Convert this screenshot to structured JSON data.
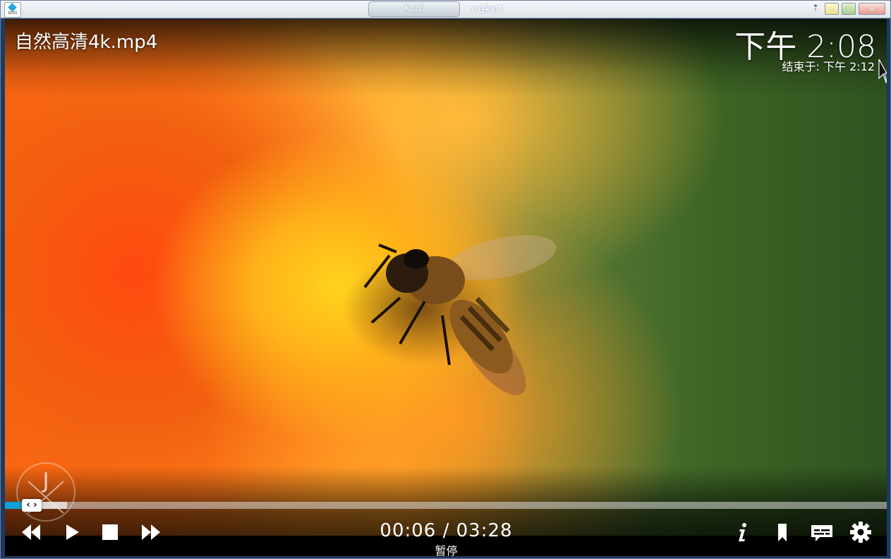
{
  "window": {
    "tab_label": "Kodi",
    "title": "veket",
    "app_icon_text": "KODI"
  },
  "player": {
    "file_name": "自然高清4k.mp4",
    "clock": "下午 2:08",
    "ends_at": "结束于: 下午 2:12",
    "time_display": "00:06 / 03:28",
    "status": "暂停",
    "progress_fraction": 0.024,
    "accent_color": "#12a0d7"
  },
  "controls": {
    "icons": [
      "rewind-icon",
      "play-icon",
      "stop-icon",
      "fast-forward-icon",
      "info-icon",
      "bookmark-icon",
      "subtitles-icon",
      "settings-icon"
    ]
  }
}
